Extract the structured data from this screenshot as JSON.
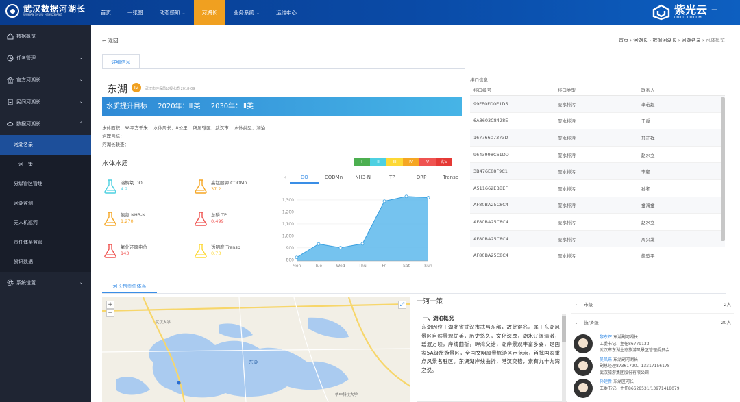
{
  "header": {
    "logo_title": "武汉数据河湖长",
    "logo_sub": "WUHAN SHUJU HEHUZHANG",
    "nav": [
      {
        "label": "首页",
        "dropdown": false,
        "active": false
      },
      {
        "label": "一张图",
        "dropdown": false,
        "active": false
      },
      {
        "label": "动态感知",
        "dropdown": true,
        "active": false
      },
      {
        "label": "河湖长",
        "dropdown": false,
        "active": true
      },
      {
        "label": "业务系统",
        "dropdown": true,
        "active": false
      },
      {
        "label": "运维中心",
        "dropdown": false,
        "active": false
      }
    ],
    "brand_cn": "紫光云",
    "brand_en": "UNICLOUD.COM",
    "accent": "#f0a020"
  },
  "sidebar": {
    "items": [
      {
        "label": "数据概览",
        "icon": "home-icon",
        "arrow": ""
      },
      {
        "label": "任务管理",
        "icon": "clock-icon",
        "arrow": "⌄"
      },
      {
        "label": "官方河湖长",
        "icon": "bank-icon",
        "arrow": "⌄"
      },
      {
        "label": "民间河湖长",
        "icon": "notebook-icon",
        "arrow": "⌄"
      },
      {
        "label": "数据河湖长",
        "icon": "cloud-icon",
        "arrow": "⌃"
      }
    ],
    "subitems": [
      "河湖名录",
      "一河一策",
      "分级管区管理",
      "河湖监测",
      "无人机巡河",
      "责任体系监管",
      "资讯数据"
    ],
    "active_sub": 0,
    "last_item": {
      "label": "系统设置",
      "icon": "gear-icon",
      "arrow": "⌄"
    }
  },
  "page": {
    "back": "← 返回",
    "breadcrumb": [
      "首页",
      "河湖长",
      "数据河湖长",
      "河湖名录"
    ],
    "breadcrumb_current": "水体概览",
    "tab": "详细信息"
  },
  "lake": {
    "name": "东湖",
    "grade": "Ⅳ",
    "source": "武汉市环保局公报水质 2018-09",
    "target_label": "水质提升目标",
    "target_2020": "2020年：Ⅲ类",
    "target_2030": "2030年：Ⅲ类",
    "area": "水体面积：88平方千米",
    "perimeter": "水体周长：8公里",
    "district": "所属辖区：武汉市",
    "type": "水体类型：湖泊",
    "line2": "治理目标：",
    "line3": "河湖长联查："
  },
  "water_quality": {
    "title": "水体水质",
    "levels": [
      {
        "label": "I",
        "color": "#4caf50"
      },
      {
        "label": "II",
        "color": "#4dd0e1"
      },
      {
        "label": "III",
        "color": "#fdd835"
      },
      {
        "label": "IV",
        "color": "#f5a623"
      },
      {
        "label": "V",
        "color": "#ef5350"
      },
      {
        "label": "劣V",
        "color": "#e53935"
      }
    ],
    "metrics": [
      {
        "name": "溶解氧 DO",
        "value": "4.2",
        "color": "#4dd0e1"
      },
      {
        "name": "高锰酸钾 CODMn",
        "value": "37.2",
        "color": "#f5a623"
      },
      {
        "name": "氨氮 NH3-N",
        "value": "1.270",
        "color": "#f5a623"
      },
      {
        "name": "总磷 TP",
        "value": "0.499",
        "color": "#ef5350"
      },
      {
        "name": "氧化还原电位",
        "value": "143",
        "color": "#ef5350"
      },
      {
        "name": "透明度 Transp",
        "value": "0.73",
        "color": "#fdd835"
      }
    ]
  },
  "chart_tabs": [
    "DO",
    "CODMn",
    "NH3-N",
    "TP",
    "ORP",
    "Transp"
  ],
  "chart_data": {
    "type": "area",
    "categories": [
      "Mon",
      "Tue",
      "Wed",
      "Thu",
      "Fri",
      "Sat",
      "Sun"
    ],
    "values": [
      820,
      932,
      901,
      934,
      1290,
      1330,
      1320
    ],
    "yticks": [
      800,
      900,
      1000,
      1100,
      1200,
      1300
    ],
    "ylim": [
      790,
      1340
    ],
    "color": "#5db8ec",
    "grid": true
  },
  "ports": {
    "title": "排口信息",
    "headers": [
      "排口编号",
      "排口类型",
      "联系人"
    ],
    "rows": [
      [
        "99FE0FD0E1D5",
        "废水排污",
        "李若超"
      ],
      [
        "6A8603C8428E",
        "废水排污",
        "王禹"
      ],
      [
        "16776607373D",
        "废水排污",
        "邢正祥"
      ],
      [
        "9643998C61DD",
        "废水排污",
        "赵水立"
      ],
      [
        "3B476E88F9C1",
        "废水排污",
        "李毅"
      ],
      [
        "A511662EBBEF",
        "废水排污",
        "孙和"
      ],
      [
        "AF80BA25C8C4",
        "废水排污",
        "金海金"
      ],
      [
        "AF80BA25C8C4",
        "废水排污",
        "赵水立"
      ],
      [
        "AF80BA25C8C4",
        "废水排污",
        "周兴发"
      ],
      [
        "AF80BA25C8C4",
        "废水排污",
        "鲍登平"
      ]
    ]
  },
  "system": {
    "tab": "河长制责任体系"
  },
  "policy": {
    "title": "一河一策",
    "heading": "一、湖泊概况",
    "body": "东湖因位于湖北省武汉市武昌东部，故此得名。属于东湖风景区自然景观优美，历史悠久，文化深厚，湖水辽阔清澈，碧波万顷，岸线曲折，岬湾交错，湖岸景观丰富多姿，是国家5A级旅游景区，全国文明风景旅游区示范点，首批国家重点风景名胜区。东湖湖岸线曲折，港汊交错，素有九十九湾之说。"
  },
  "tree": {
    "rows": [
      {
        "name": "市级",
        "count": "2人",
        "arrow": "›"
      },
      {
        "name": "街/乡级",
        "count": "20人",
        "arrow": "⌄"
      }
    ],
    "people": [
      {
        "name": "黎东辉",
        "role": "东湖副河湖长",
        "l1": "工委书记、主任86779133",
        "l2": "武汉市东湖生态旅游风景区管理委员会"
      },
      {
        "name": "吴凤来",
        "role": "东湖副河湖长",
        "l1": "副总经理87361790、13317156178",
        "l2": "武汉旅游集团股份有限公司"
      },
      {
        "name": "孙建新",
        "role": "东湖区河长",
        "l1": "工委书记、主任86628531/13971418079",
        "l2": ""
      }
    ]
  },
  "map": {
    "labels": [
      "东湖",
      "武汉大学",
      "华中科技大学"
    ]
  }
}
